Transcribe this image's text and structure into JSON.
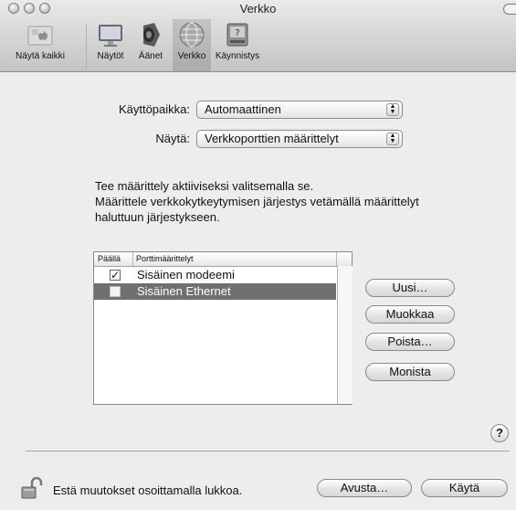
{
  "window": {
    "title": "Verkko"
  },
  "toolbar": {
    "items": [
      {
        "label": "Näytä kaikki",
        "icon": "apple-icon"
      },
      {
        "label": "Näytöt",
        "icon": "display-icon"
      },
      {
        "label": "Äänet",
        "icon": "speaker-icon"
      },
      {
        "label": "Verkko",
        "icon": "network-globe-icon",
        "selected": true
      },
      {
        "label": "Käynnistys",
        "icon": "startup-disk-icon"
      }
    ]
  },
  "location": {
    "label": "Käyttöpaikka:",
    "value": "Automaattinen"
  },
  "show": {
    "label": "Näytä:",
    "value": "Verkkoporttien määrittelyt"
  },
  "info": {
    "line1": "Tee määrittely aktiiviseksi valitsemalla se.",
    "line2": "Määrittele verkkokytkeytymisen järjestys vetämällä määrittelyt",
    "line3": "haluttuun järjestykseen."
  },
  "table": {
    "columns": [
      "Päällä",
      "Porttimäärittelyt"
    ],
    "rows": [
      {
        "enabled": true,
        "name": "Sisäinen modeemi",
        "selected": false
      },
      {
        "enabled": false,
        "name": "Sisäinen Ethernet",
        "selected": true
      }
    ]
  },
  "buttons": {
    "new": "Uusi…",
    "edit": "Muokkaa",
    "delete": "Poista…",
    "duplicate": "Monista"
  },
  "footer": {
    "lock_text": "Estä muutokset osoittamalla lukkoa.",
    "assist": "Avusta…",
    "apply": "Käytä"
  },
  "help": {
    "symbol": "?"
  },
  "colors": {
    "selection": "#707070"
  }
}
